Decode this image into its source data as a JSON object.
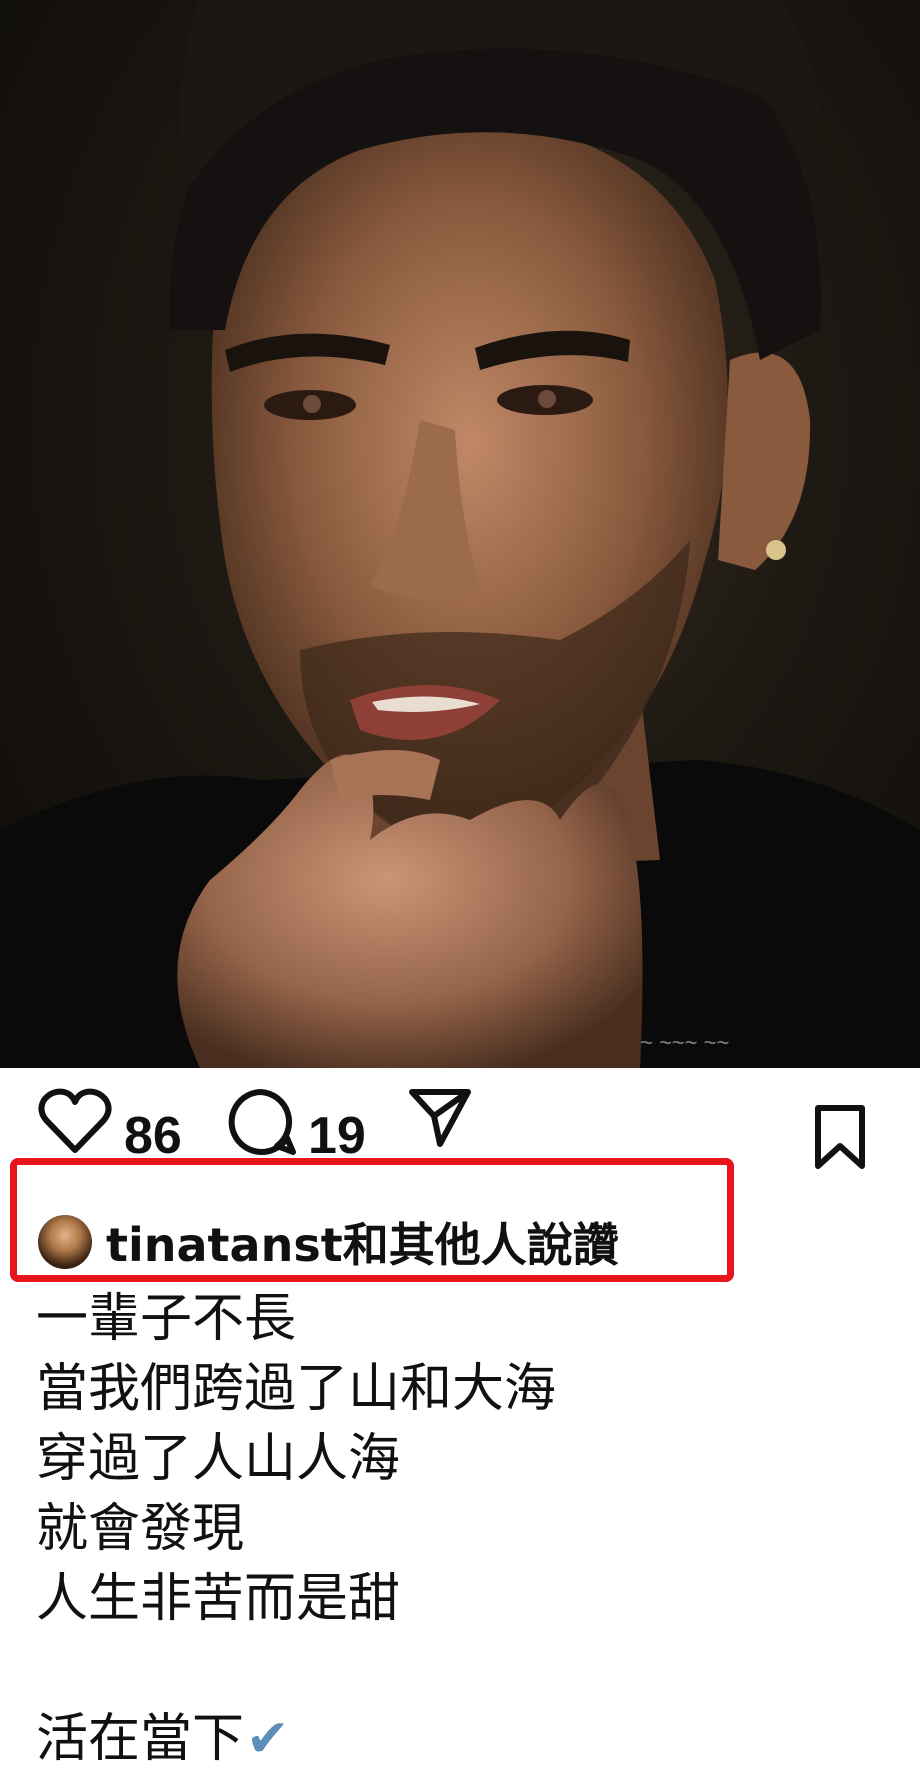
{
  "post": {
    "like_count": "86",
    "comment_count": "19",
    "liked_by": "tinatanst和其他人說讚",
    "caption_lines": [
      "一輩子不長",
      "當我們跨過了山和大海",
      "穿過了人山人海",
      "就會發現",
      "人生非苦而是甜",
      "",
      "活在當下"
    ],
    "caption_end_emoji": "✔"
  },
  "icons": {
    "like": "heart-outline-icon",
    "comment": "speech-bubble-icon",
    "share": "paper-plane-icon",
    "save": "bookmark-icon"
  },
  "colors": {
    "highlight_border": "#e8161b",
    "check_mark": "#5b8fb9"
  }
}
